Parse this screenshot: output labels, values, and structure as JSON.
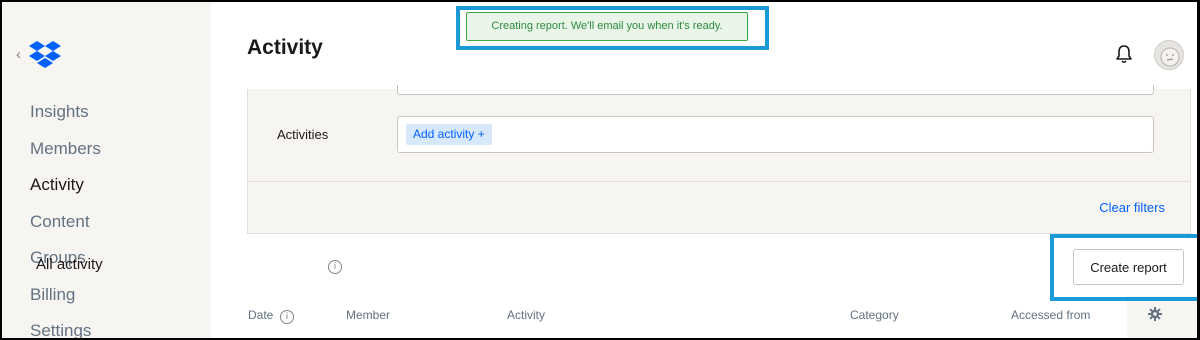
{
  "sidebar": {
    "back_label": "‹",
    "logo_icon": "dropbox-logo",
    "items": [
      {
        "label": "Insights",
        "active": false
      },
      {
        "label": "Members",
        "active": false
      },
      {
        "label": "Activity",
        "active": true
      },
      {
        "label": "Content",
        "active": false
      },
      {
        "label": "Groups",
        "active": false
      },
      {
        "label": "Billing",
        "active": false
      },
      {
        "label": "Settings",
        "active": false
      }
    ]
  },
  "header": {
    "title": "Activity",
    "bell_icon": "bell-icon",
    "avatar_icon": "avatar"
  },
  "toast": {
    "message": "Creating report. We'll email you when it's ready."
  },
  "filters": {
    "activities_label": "Activities",
    "add_activity_chip": "Add activity +",
    "clear_filters": "Clear filters"
  },
  "table": {
    "section_title": "All activity",
    "info_icon": "i",
    "create_report_label": "Create report",
    "columns": [
      "Date",
      "Member",
      "Activity",
      "Category",
      "Accessed from"
    ]
  },
  "colors": {
    "accent_blue": "#0061fe",
    "highlight_box": "#1a9bd7",
    "toast_green": "#2e8b3d",
    "sidebar_bg": "#f7f5f2"
  }
}
